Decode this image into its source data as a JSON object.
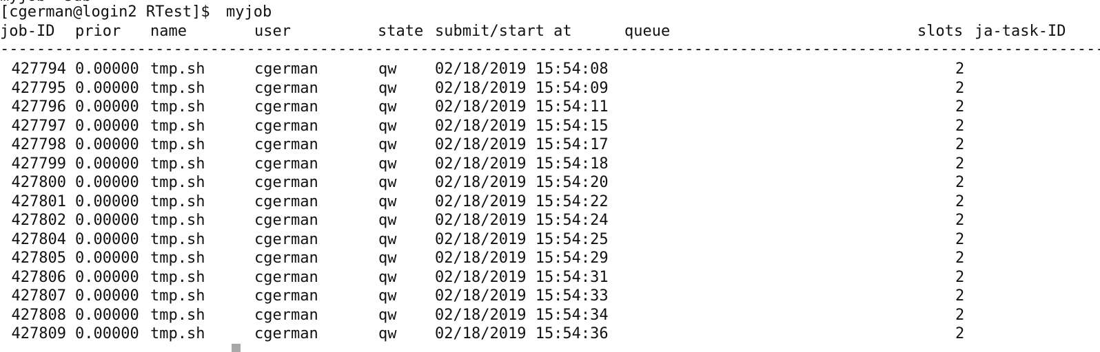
{
  "terminal": {
    "cut_prompt_fragment": "myjob  sub",
    "prompt": {
      "text": "[cgerman@login2 RTest]$ ",
      "command": "myjob"
    },
    "columns": {
      "job_id": "job-ID",
      "prior": "prior",
      "name": "name",
      "user": "user",
      "state": "state",
      "submit": "submit/start at",
      "queue": "queue",
      "slots": "slots",
      "ja_task": "ja-task-ID"
    },
    "separator": "-----------------------------------------------------------------------------------------------------------------------------------------------------------",
    "rows": [
      {
        "job_id": "427794",
        "prior": "0.00000",
        "name": "tmp.sh",
        "user": "cgerman",
        "state": "qw",
        "submit": "02/18/2019 15:54:08",
        "slots": "2"
      },
      {
        "job_id": "427795",
        "prior": "0.00000",
        "name": "tmp.sh",
        "user": "cgerman",
        "state": "qw",
        "submit": "02/18/2019 15:54:09",
        "slots": "2"
      },
      {
        "job_id": "427796",
        "prior": "0.00000",
        "name": "tmp.sh",
        "user": "cgerman",
        "state": "qw",
        "submit": "02/18/2019 15:54:11",
        "slots": "2"
      },
      {
        "job_id": "427797",
        "prior": "0.00000",
        "name": "tmp.sh",
        "user": "cgerman",
        "state": "qw",
        "submit": "02/18/2019 15:54:15",
        "slots": "2"
      },
      {
        "job_id": "427798",
        "prior": "0.00000",
        "name": "tmp.sh",
        "user": "cgerman",
        "state": "qw",
        "submit": "02/18/2019 15:54:17",
        "slots": "2"
      },
      {
        "job_id": "427799",
        "prior": "0.00000",
        "name": "tmp.sh",
        "user": "cgerman",
        "state": "qw",
        "submit": "02/18/2019 15:54:18",
        "slots": "2"
      },
      {
        "job_id": "427800",
        "prior": "0.00000",
        "name": "tmp.sh",
        "user": "cgerman",
        "state": "qw",
        "submit": "02/18/2019 15:54:20",
        "slots": "2"
      },
      {
        "job_id": "427801",
        "prior": "0.00000",
        "name": "tmp.sh",
        "user": "cgerman",
        "state": "qw",
        "submit": "02/18/2019 15:54:22",
        "slots": "2"
      },
      {
        "job_id": "427802",
        "prior": "0.00000",
        "name": "tmp.sh",
        "user": "cgerman",
        "state": "qw",
        "submit": "02/18/2019 15:54:24",
        "slots": "2"
      },
      {
        "job_id": "427804",
        "prior": "0.00000",
        "name": "tmp.sh",
        "user": "cgerman",
        "state": "qw",
        "submit": "02/18/2019 15:54:25",
        "slots": "2"
      },
      {
        "job_id": "427805",
        "prior": "0.00000",
        "name": "tmp.sh",
        "user": "cgerman",
        "state": "qw",
        "submit": "02/18/2019 15:54:29",
        "slots": "2"
      },
      {
        "job_id": "427806",
        "prior": "0.00000",
        "name": "tmp.sh",
        "user": "cgerman",
        "state": "qw",
        "submit": "02/18/2019 15:54:31",
        "slots": "2"
      },
      {
        "job_id": "427807",
        "prior": "0.00000",
        "name": "tmp.sh",
        "user": "cgerman",
        "state": "qw",
        "submit": "02/18/2019 15:54:33",
        "slots": "2"
      },
      {
        "job_id": "427808",
        "prior": "0.00000",
        "name": "tmp.sh",
        "user": "cgerman",
        "state": "qw",
        "submit": "02/18/2019 15:54:34",
        "slots": "2"
      },
      {
        "job_id": "427809",
        "prior": "0.00000",
        "name": "tmp.sh",
        "user": "cgerman",
        "state": "qw",
        "submit": "02/18/2019 15:54:36",
        "slots": "2"
      }
    ]
  }
}
